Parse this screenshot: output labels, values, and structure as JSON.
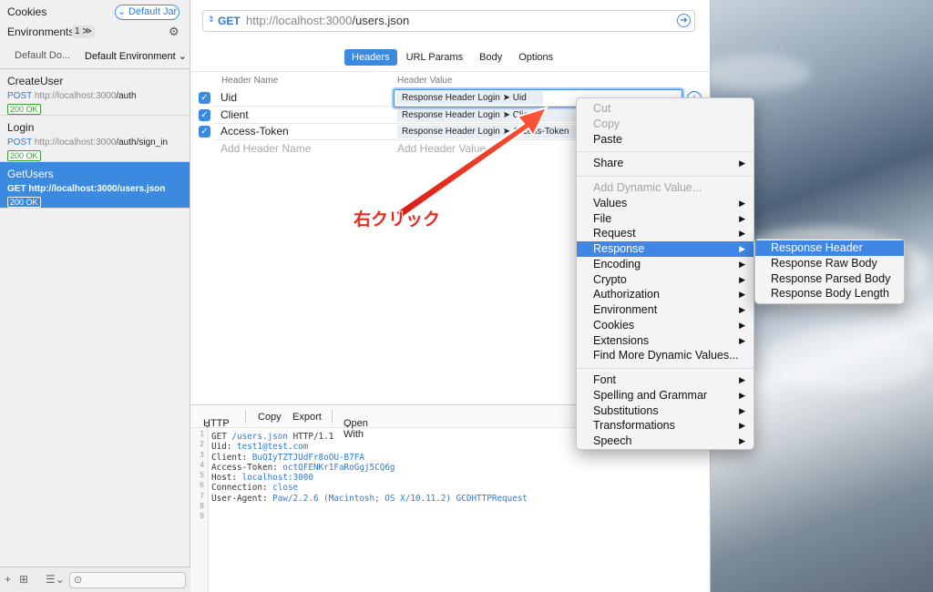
{
  "sidebar": {
    "cookies": "Cookies",
    "cookie_jar": "Default Jar",
    "environments": "Environments",
    "env_count": "1",
    "env_domain": "Default Do...",
    "env_name": "Default Environment",
    "requests": [
      {
        "name": "CreateUser",
        "method": "POST",
        "host": "http://localhost:3000",
        "path": "/auth",
        "status": "200 OK"
      },
      {
        "name": "Login",
        "method": "POST",
        "host": "http://localhost:3000",
        "path": "/auth/sign_in",
        "status": "200 OK"
      },
      {
        "name": "GetUsers",
        "method": "GET",
        "url": "http://localhost:3000/users.json",
        "status": "200 OK"
      }
    ]
  },
  "urlbar": {
    "method": "GET",
    "host": "http://localhost:3000",
    "path": "/users.json"
  },
  "tabs": [
    "Headers",
    "URL Params",
    "Body",
    "Options"
  ],
  "headers_table": {
    "col_name": "Header Name",
    "col_value": "Header Value",
    "rows": [
      {
        "name": "Uid",
        "value": "Response Header  Login ➤ Uid"
      },
      {
        "name": "Client",
        "value": "Response Header  Login ➤ Client"
      },
      {
        "name": "Access-Token",
        "value": "Response Header  Login ➤ Access-Token"
      }
    ],
    "add_name": "Add Header Name",
    "add_value": "Add Header Value"
  },
  "http_pane": {
    "format": "HTTP",
    "copy": "Copy",
    "export": "Export",
    "open_with": "Open With"
  },
  "code_lines": [
    {
      "k": "GET ",
      "v": "/users.json",
      "r": " HTTP/1.1"
    },
    {
      "k": "Uid: ",
      "v": "test1@test.com",
      "r": ""
    },
    {
      "k": "Client: ",
      "v": "BuQIyTZTJUdFr8oOU-B7FA",
      "r": ""
    },
    {
      "k": "Access-Token: ",
      "v": "octQFENKr1FaRoGgj5CQ6g",
      "r": ""
    },
    {
      "k": "Host: ",
      "v": "localhost:3000",
      "r": ""
    },
    {
      "k": "Connection: ",
      "v": "close",
      "r": ""
    },
    {
      "k": "User-Agent: ",
      "v": "Paw/2.2.6 (Macintosh; OS X/10.11.2) GCDHTTPRequest",
      "r": ""
    },
    {
      "k": "",
      "v": "",
      "r": ""
    },
    {
      "k": "",
      "v": "",
      "r": ""
    }
  ],
  "context_menu": {
    "items": [
      {
        "label": "Cut",
        "disabled": true
      },
      {
        "label": "Copy",
        "disabled": true
      },
      {
        "label": "Paste"
      },
      {
        "sep": true
      },
      {
        "label": "Share",
        "sub": true
      },
      {
        "sep": true
      },
      {
        "label": "Add Dynamic Value...",
        "disabled": true
      },
      {
        "label": "Values",
        "sub": true
      },
      {
        "label": "File",
        "sub": true
      },
      {
        "label": "Request",
        "sub": true
      },
      {
        "label": "Response",
        "sub": true,
        "highlighted": true
      },
      {
        "label": "Encoding",
        "sub": true
      },
      {
        "label": "Crypto",
        "sub": true
      },
      {
        "label": "Authorization",
        "sub": true
      },
      {
        "label": "Environment",
        "sub": true
      },
      {
        "label": "Cookies",
        "sub": true
      },
      {
        "label": "Extensions",
        "sub": true
      },
      {
        "label": "Find More Dynamic Values..."
      },
      {
        "sep": true
      },
      {
        "label": "Font",
        "sub": true
      },
      {
        "label": "Spelling and Grammar",
        "sub": true
      },
      {
        "label": "Substitutions",
        "sub": true
      },
      {
        "label": "Transformations",
        "sub": true
      },
      {
        "label": "Speech",
        "sub": true
      }
    ],
    "submenu": [
      "Response Header",
      "Response Raw Body",
      "Response Parsed Body",
      "Response Body Length"
    ]
  },
  "annotation": "右クリック",
  "colors": {
    "accent": "#3b8ae0",
    "annotation": "#e8291c",
    "status_ok": "#3a9d35"
  }
}
